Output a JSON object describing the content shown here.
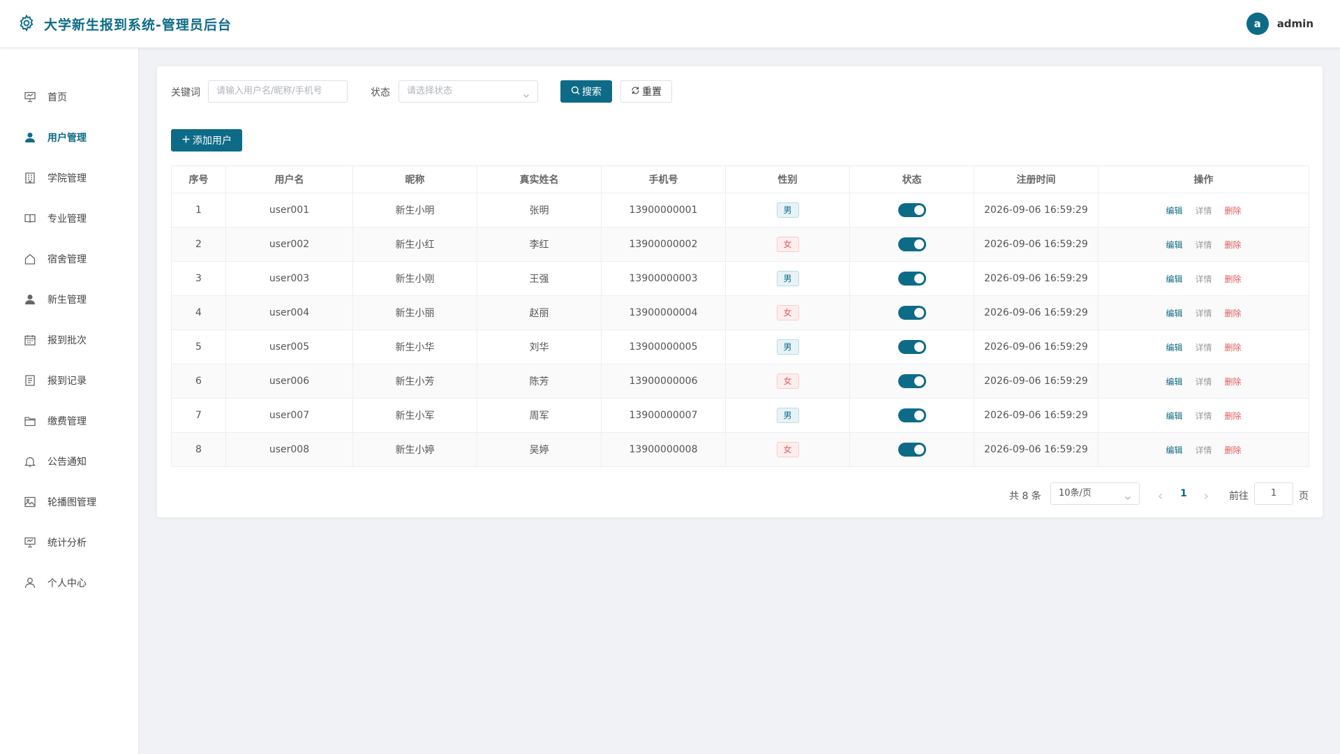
{
  "header": {
    "title": "大学新生报到系统-管理员后台",
    "avatar_letter": "a",
    "username": "admin"
  },
  "sidebar": {
    "active": "用户管理",
    "items": [
      {
        "label": "首页",
        "icon": "presentation-icon"
      },
      {
        "label": "用户管理",
        "icon": "user-icon"
      },
      {
        "label": "学院管理",
        "icon": "building-icon"
      },
      {
        "label": "专业管理",
        "icon": "book-icon"
      },
      {
        "label": "宿舍管理",
        "icon": "house-icon"
      },
      {
        "label": "新生管理",
        "icon": "user-icon"
      },
      {
        "label": "报到批次",
        "icon": "calendar-icon"
      },
      {
        "label": "报到记录",
        "icon": "document-icon"
      },
      {
        "label": "缴费管理",
        "icon": "folder-icon"
      },
      {
        "label": "公告通知",
        "icon": "bell-icon"
      },
      {
        "label": "轮播图管理",
        "icon": "picture-icon"
      },
      {
        "label": "统计分析",
        "icon": "presentation-icon"
      },
      {
        "label": "个人中心",
        "icon": "user-outline-icon"
      }
    ]
  },
  "filters": {
    "keyword_label": "关键词",
    "keyword_placeholder": "请输入用户名/昵称/手机号",
    "status_label": "状态",
    "status_placeholder": "请选择状态",
    "search_label": "搜索",
    "reset_label": "重置"
  },
  "toolbar": {
    "add_label": "添加用户"
  },
  "table": {
    "columns": [
      "序号",
      "用户名",
      "昵称",
      "真实姓名",
      "手机号",
      "性别",
      "状态",
      "注册时间",
      "操作"
    ],
    "rows": [
      {
        "index": "1",
        "username": "user001",
        "nickname": "新生小明",
        "realname": "张明",
        "phone": "13900000001",
        "gender": "男",
        "status_on": true,
        "registered": "2026-09-06 16:59:29"
      },
      {
        "index": "2",
        "username": "user002",
        "nickname": "新生小红",
        "realname": "李红",
        "phone": "13900000002",
        "gender": "女",
        "status_on": true,
        "registered": "2026-09-06 16:59:29"
      },
      {
        "index": "3",
        "username": "user003",
        "nickname": "新生小刚",
        "realname": "王强",
        "phone": "13900000003",
        "gender": "男",
        "status_on": true,
        "registered": "2026-09-06 16:59:29"
      },
      {
        "index": "4",
        "username": "user004",
        "nickname": "新生小丽",
        "realname": "赵丽",
        "phone": "13900000004",
        "gender": "女",
        "status_on": true,
        "registered": "2026-09-06 16:59:29"
      },
      {
        "index": "5",
        "username": "user005",
        "nickname": "新生小华",
        "realname": "刘华",
        "phone": "13900000005",
        "gender": "男",
        "status_on": true,
        "registered": "2026-09-06 16:59:29"
      },
      {
        "index": "6",
        "username": "user006",
        "nickname": "新生小芳",
        "realname": "陈芳",
        "phone": "13900000006",
        "gender": "女",
        "status_on": true,
        "registered": "2026-09-06 16:59:29"
      },
      {
        "index": "7",
        "username": "user007",
        "nickname": "新生小军",
        "realname": "周军",
        "phone": "13900000007",
        "gender": "男",
        "status_on": true,
        "registered": "2026-09-06 16:59:29"
      },
      {
        "index": "8",
        "username": "user008",
        "nickname": "新生小婷",
        "realname": "吴婷",
        "phone": "13900000008",
        "gender": "女",
        "status_on": true,
        "registered": "2026-09-06 16:59:29"
      }
    ],
    "actions": {
      "edit": "编辑",
      "detail": "详情",
      "delete": "删除"
    }
  },
  "pagination": {
    "total_text": "共 8 条",
    "page_size": "10条/页",
    "current_page": "1",
    "goto_label": "前往",
    "goto_value": "1",
    "page_suffix": "页"
  },
  "colors": {
    "primary": "#0e6b87",
    "danger": "#e15b5b",
    "background": "#f0f2f5"
  }
}
